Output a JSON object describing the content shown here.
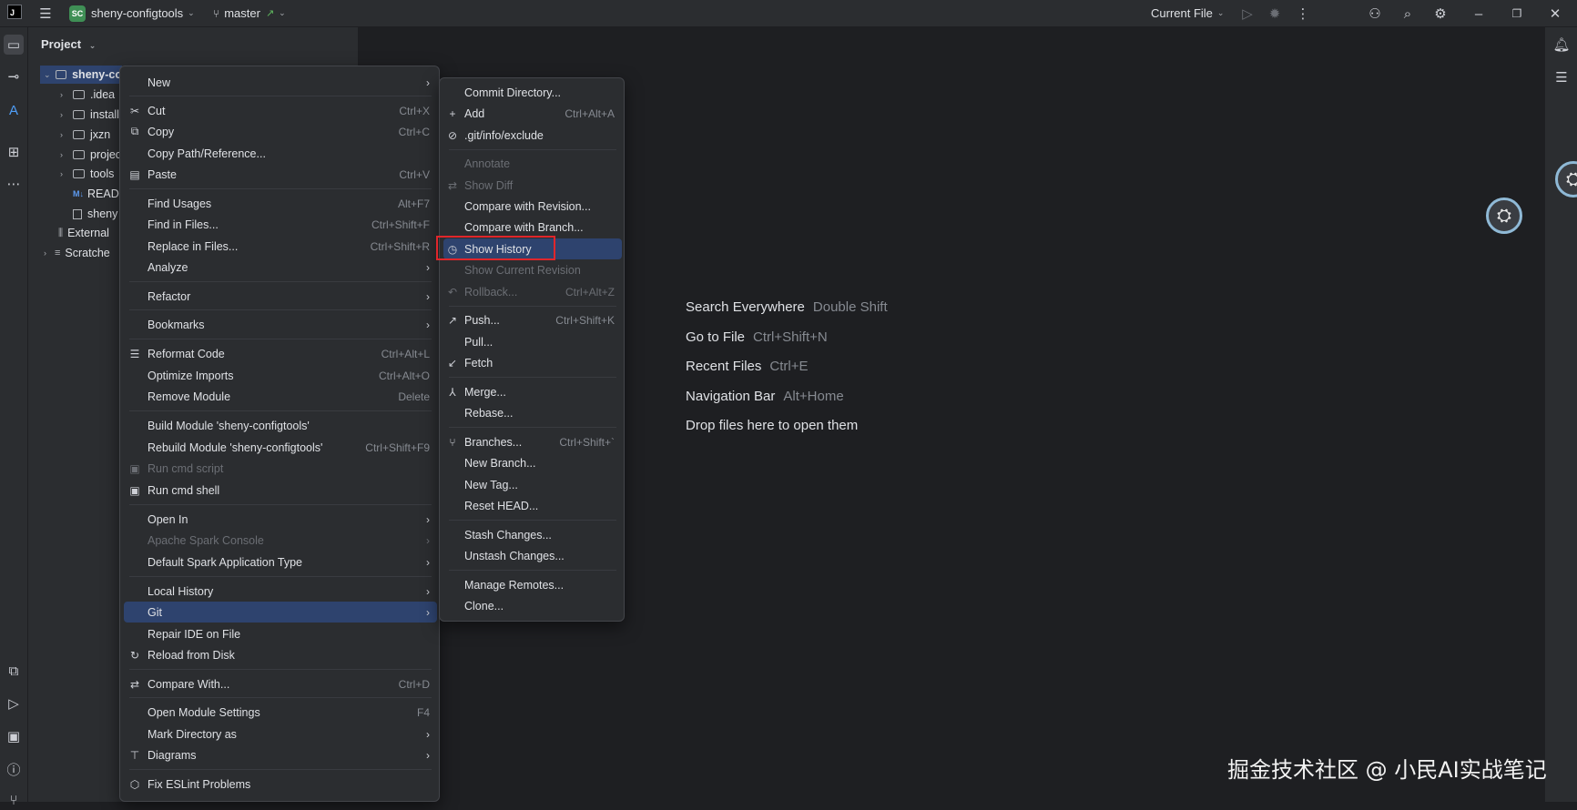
{
  "titlebar": {
    "logo_text": "J",
    "project_badge": "SC",
    "project_name": "sheny-configtools",
    "branch": "master",
    "branch_arrow": "↗",
    "run_config": "Current File"
  },
  "project_panel": {
    "title": "Project",
    "tree": [
      {
        "label": "sheny-co",
        "type": "folder",
        "expanded": true
      },
      {
        "label": ".idea",
        "type": "folder"
      },
      {
        "label": "install",
        "type": "folder"
      },
      {
        "label": "jxzn",
        "type": "folder"
      },
      {
        "label": "projec",
        "type": "folder"
      },
      {
        "label": "tools",
        "type": "folder"
      },
      {
        "label": "READ",
        "type": "markdown"
      },
      {
        "label": "sheny",
        "type": "file"
      },
      {
        "label": "External",
        "type": "library"
      },
      {
        "label": "Scratche",
        "type": "scratch"
      }
    ]
  },
  "context_menu": {
    "items": [
      {
        "label": "New",
        "shortcut": "",
        "submenu": true
      },
      {
        "label": "Cut",
        "shortcut": "Ctrl+X",
        "icon": "cut-icon"
      },
      {
        "label": "Copy",
        "shortcut": "Ctrl+C",
        "icon": "copy-icon"
      },
      {
        "label": "Copy Path/Reference...",
        "shortcut": ""
      },
      {
        "label": "Paste",
        "shortcut": "Ctrl+V",
        "icon": "paste-icon"
      },
      {
        "label": "Find Usages",
        "shortcut": "Alt+F7"
      },
      {
        "label": "Find in Files...",
        "shortcut": "Ctrl+Shift+F"
      },
      {
        "label": "Replace in Files...",
        "shortcut": "Ctrl+Shift+R"
      },
      {
        "label": "Analyze",
        "shortcut": "",
        "submenu": true
      },
      {
        "label": "Refactor",
        "shortcut": "",
        "submenu": true
      },
      {
        "label": "Bookmarks",
        "shortcut": "",
        "submenu": true
      },
      {
        "label": "Reformat Code",
        "shortcut": "Ctrl+Alt+L",
        "icon": "reformat-icon"
      },
      {
        "label": "Optimize Imports",
        "shortcut": "Ctrl+Alt+O"
      },
      {
        "label": "Remove Module",
        "shortcut": "Delete"
      },
      {
        "label": "Build Module 'sheny-configtools'",
        "shortcut": ""
      },
      {
        "label": "Rebuild Module 'sheny-configtools'",
        "shortcut": "Ctrl+Shift+F9"
      },
      {
        "label": "Run cmd script",
        "shortcut": "",
        "disabled": true
      },
      {
        "label": "Run cmd shell",
        "shortcut": ""
      },
      {
        "label": "Open In",
        "shortcut": "",
        "submenu": true
      },
      {
        "label": "Apache Spark Console",
        "shortcut": "",
        "submenu": true,
        "disabled": true
      },
      {
        "label": "Default Spark Application Type",
        "shortcut": "",
        "submenu": true
      },
      {
        "label": "Local History",
        "shortcut": "",
        "submenu": true
      },
      {
        "label": "Git",
        "shortcut": "",
        "submenu": true,
        "selected": true
      },
      {
        "label": "Repair IDE on File",
        "shortcut": ""
      },
      {
        "label": "Reload from Disk",
        "shortcut": ""
      },
      {
        "label": "Compare With...",
        "shortcut": "Ctrl+D"
      },
      {
        "label": "Open Module Settings",
        "shortcut": "F4"
      },
      {
        "label": "Mark Directory as",
        "shortcut": "",
        "submenu": true
      },
      {
        "label": "Diagrams",
        "shortcut": "",
        "submenu": true
      },
      {
        "label": "Fix ESLint Problems",
        "shortcut": ""
      }
    ]
  },
  "git_submenu": {
    "items": [
      {
        "label": "Commit Directory...",
        "shortcut": ""
      },
      {
        "label": "Add",
        "shortcut": "Ctrl+Alt+A"
      },
      {
        "label": ".git/info/exclude",
        "shortcut": ""
      },
      {
        "label": "Annotate",
        "shortcut": "",
        "disabled": true
      },
      {
        "label": "Show Diff",
        "shortcut": "",
        "disabled": true
      },
      {
        "label": "Compare with Revision...",
        "shortcut": ""
      },
      {
        "label": "Compare with Branch...",
        "shortcut": ""
      },
      {
        "label": "Show History",
        "shortcut": "",
        "selected": true
      },
      {
        "label": "Show Current Revision",
        "shortcut": "",
        "disabled": true
      },
      {
        "label": "Rollback...",
        "shortcut": "Ctrl+Alt+Z",
        "disabled": true
      },
      {
        "label": "Push...",
        "shortcut": "Ctrl+Shift+K"
      },
      {
        "label": "Pull...",
        "shortcut": ""
      },
      {
        "label": "Fetch",
        "shortcut": ""
      },
      {
        "label": "Merge...",
        "shortcut": ""
      },
      {
        "label": "Rebase...",
        "shortcut": ""
      },
      {
        "label": "Branches...",
        "shortcut": "Ctrl+Shift+`"
      },
      {
        "label": "New Branch...",
        "shortcut": ""
      },
      {
        "label": "New Tag...",
        "shortcut": ""
      },
      {
        "label": "Reset HEAD...",
        "shortcut": ""
      },
      {
        "label": "Stash Changes...",
        "shortcut": ""
      },
      {
        "label": "Unstash Changes...",
        "shortcut": ""
      },
      {
        "label": "Manage Remotes...",
        "shortcut": ""
      },
      {
        "label": "Clone...",
        "shortcut": ""
      }
    ]
  },
  "editor_hints": [
    {
      "label": "Search Everywhere",
      "key": "Double Shift"
    },
    {
      "label": "Go to File",
      "key": "Ctrl+Shift+N"
    },
    {
      "label": "Recent Files",
      "key": "Ctrl+E"
    },
    {
      "label": "Navigation Bar",
      "key": "Alt+Home"
    },
    {
      "label": "Drop files here to open them",
      "key": ""
    }
  ],
  "watermark": "掘金技术社区 @ 小民AI实战笔记",
  "colors": {
    "background": "#1e1f22",
    "panel": "#2b2d30",
    "selection": "#2e436e",
    "highlight_box": "#e0262b"
  }
}
